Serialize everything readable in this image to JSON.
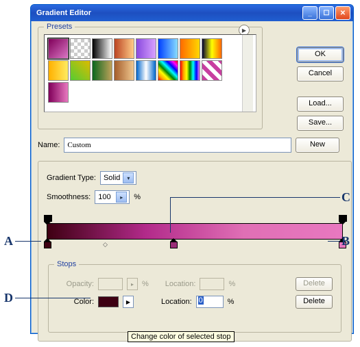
{
  "window": {
    "title": "Gradient Editor"
  },
  "buttons": {
    "ok": "OK",
    "cancel": "Cancel",
    "load": "Load...",
    "save": "Save...",
    "new": "New",
    "delete_opacity": "Delete",
    "delete_color": "Delete"
  },
  "presets": {
    "legend": "Presets",
    "swatches": [
      "linear-gradient(135deg,#80005a,#d977c4)",
      "repeating-conic-gradient(#ccc 0 25%, #fff 0 50%) 0 0/10px 10px",
      "linear-gradient(to right,#000,#fff)",
      "linear-gradient(to right,#b42,#fc8)",
      "linear-gradient(to right,#8a4ade,#d8a1ff)",
      "linear-gradient(to right,#0040ff,#88ddff)",
      "linear-gradient(to right,#ff6a00,#ffd800)",
      "linear-gradient(to right,#003,#ff0,#f60)",
      "linear-gradient(to right,#ffb000,#ffec60)",
      "linear-gradient(45deg,#5c3,#db0)",
      "linear-gradient(to right,#0a661f,#bfa25a)",
      "linear-gradient(to right,#a45c2a,#f0c890)",
      "linear-gradient(90deg,#06c,#fff,#06c)",
      "linear-gradient(45deg,red,orange,yellow,green,cyan,blue,magenta,red)",
      "linear-gradient(to right,red,orange,yellow,green,cyan,blue,violet)",
      "repeating-linear-gradient(45deg,#c83ea0 0 6px,#fff 6px 12px)",
      "linear-gradient(to right,#80005a,#e878c0)"
    ]
  },
  "name": {
    "label": "Name:",
    "value": "Custom"
  },
  "gradient_type": {
    "label": "Gradient Type:",
    "value": "Solid"
  },
  "smoothness": {
    "label": "Smoothness:",
    "value": "100",
    "unit": "%"
  },
  "gradient": {
    "opacity_stops": [
      {
        "pos": 0
      },
      {
        "pos": 100
      }
    ],
    "color_stops": [
      {
        "pos": 0,
        "color": "#3e0012"
      },
      {
        "pos": 44,
        "color": "#9b2d78"
      },
      {
        "pos": 100,
        "color": "#e878c0"
      }
    ]
  },
  "stops": {
    "legend": "Stops",
    "opacity_label": "Opacity:",
    "opacity_unit": "%",
    "location_label": "Location:",
    "location_unit": "%",
    "color_label": "Color:",
    "color_value": "#3e0012",
    "location_value": "0"
  },
  "tooltip": "Change color of selected stop",
  "annotations": {
    "A": "A",
    "B": "B",
    "C": "C",
    "D": "D"
  }
}
